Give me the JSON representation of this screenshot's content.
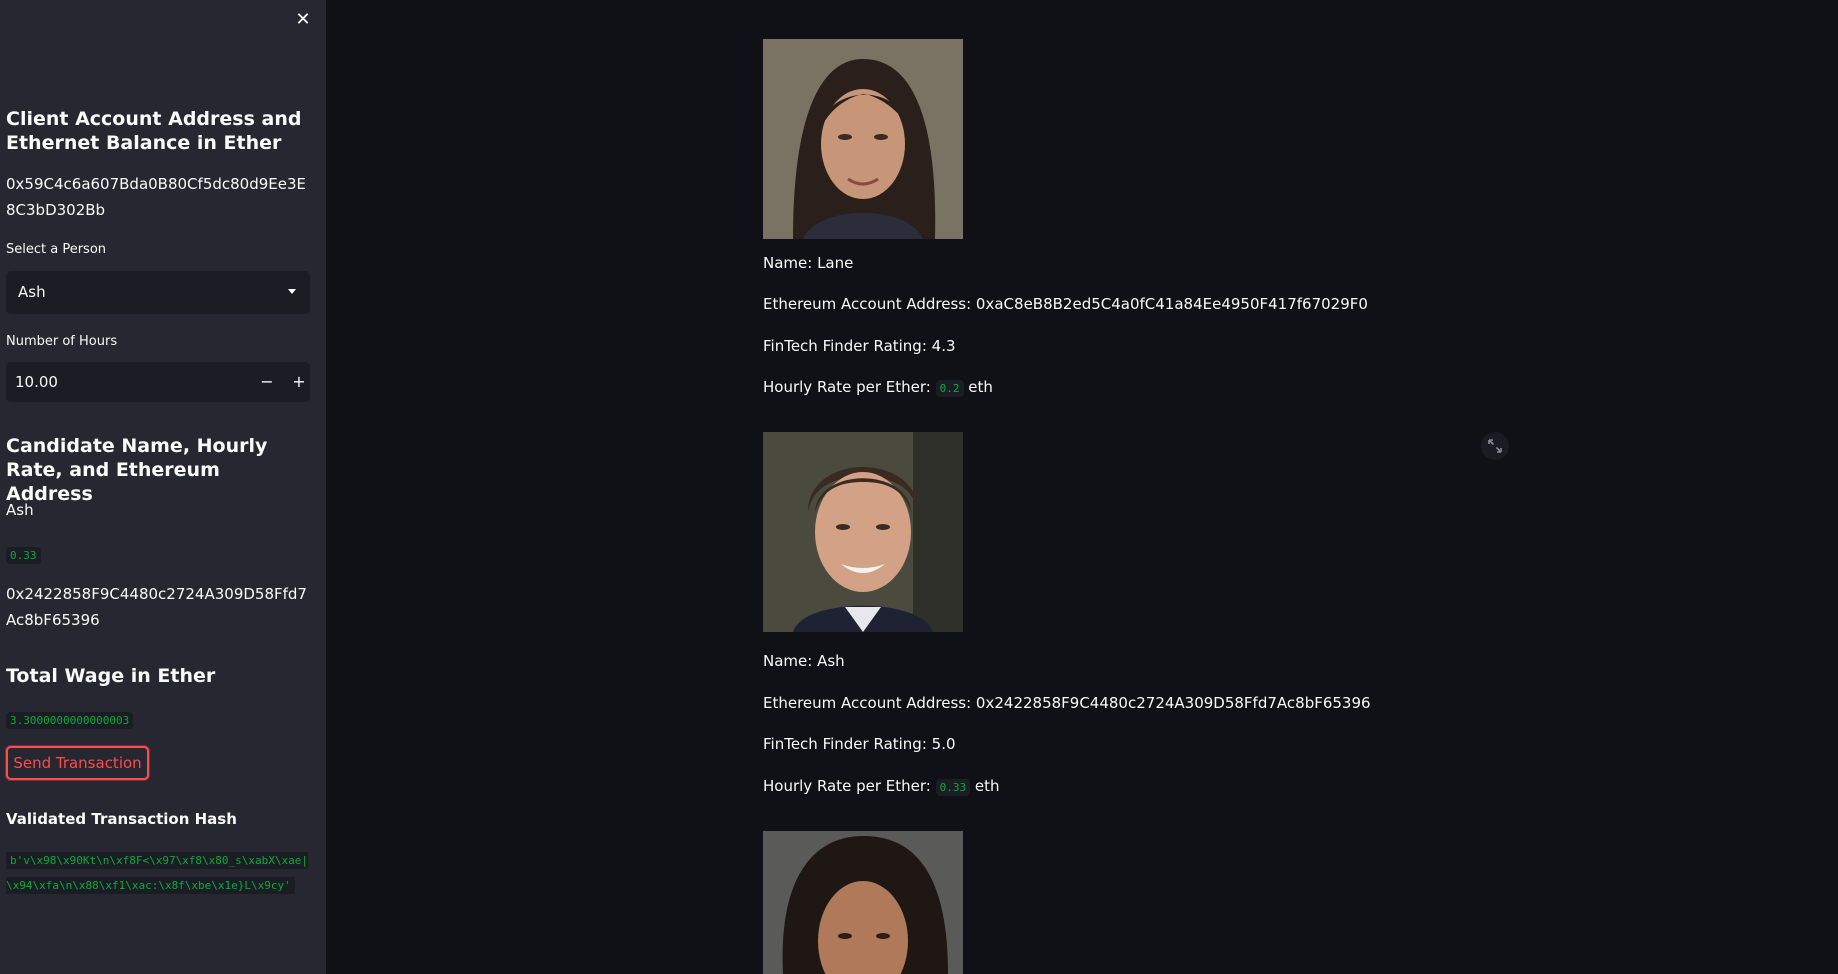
{
  "sidebar": {
    "close_icon": "close-icon",
    "account_heading": "Client Account Address and Ethernet Balance in Ether",
    "account_address": "0x59C4c6a607Bda0B80Cf5dc80d9Ee3E8C3bD302Bb",
    "select_label": "Select a Person",
    "select_value": "Ash",
    "hours_label": "Number of Hours",
    "hours_value": "10.00",
    "minus_label": "−",
    "plus_label": "+",
    "candidate_heading": "Candidate Name, Hourly Rate, and Ethereum Address",
    "candidate_name": "Ash",
    "candidate_rate": "0.33",
    "candidate_address": "0x2422858F9C4480c2724A309D58Ffd7Ac8bF65396",
    "wage_heading": "Total Wage in Ether",
    "wage_value": "3.3000000000000003",
    "send_button": "Send Transaction",
    "hash_heading": "Validated Transaction Hash",
    "hash_value": "b'v\\x98\\x90Kt\\n\\xf8F<\\x97\\xf8\\x80_s\\xabX\\xae|\\x94\\xfa\\n\\x88\\xf1\\xac:\\x8f\\xbe\\x1e}L\\x9cy'"
  },
  "candidates": [
    {
      "name": "Name: Lane",
      "address": "Ethereum Account Address: 0xaC8eB8B2ed5C4a0fC41a84Ee4950F417f67029F0",
      "rating": "FinTech Finder Rating: 4.3",
      "rate_prefix": "Hourly Rate per Ether:",
      "rate": "0.2",
      "rate_suffix": "eth"
    },
    {
      "name": "Name: Ash",
      "address": "Ethereum Account Address: 0x2422858F9C4480c2724A309D58Ffd7Ac8bF65396",
      "rating": "FinTech Finder Rating: 5.0",
      "rate_prefix": "Hourly Rate per Ether:",
      "rate": "0.33",
      "rate_suffix": "eth"
    }
  ],
  "colors": {
    "background": "#0f1117",
    "sidebar": "#262730",
    "accent": "#ff4b4b",
    "code_text": "#09ab3b"
  }
}
